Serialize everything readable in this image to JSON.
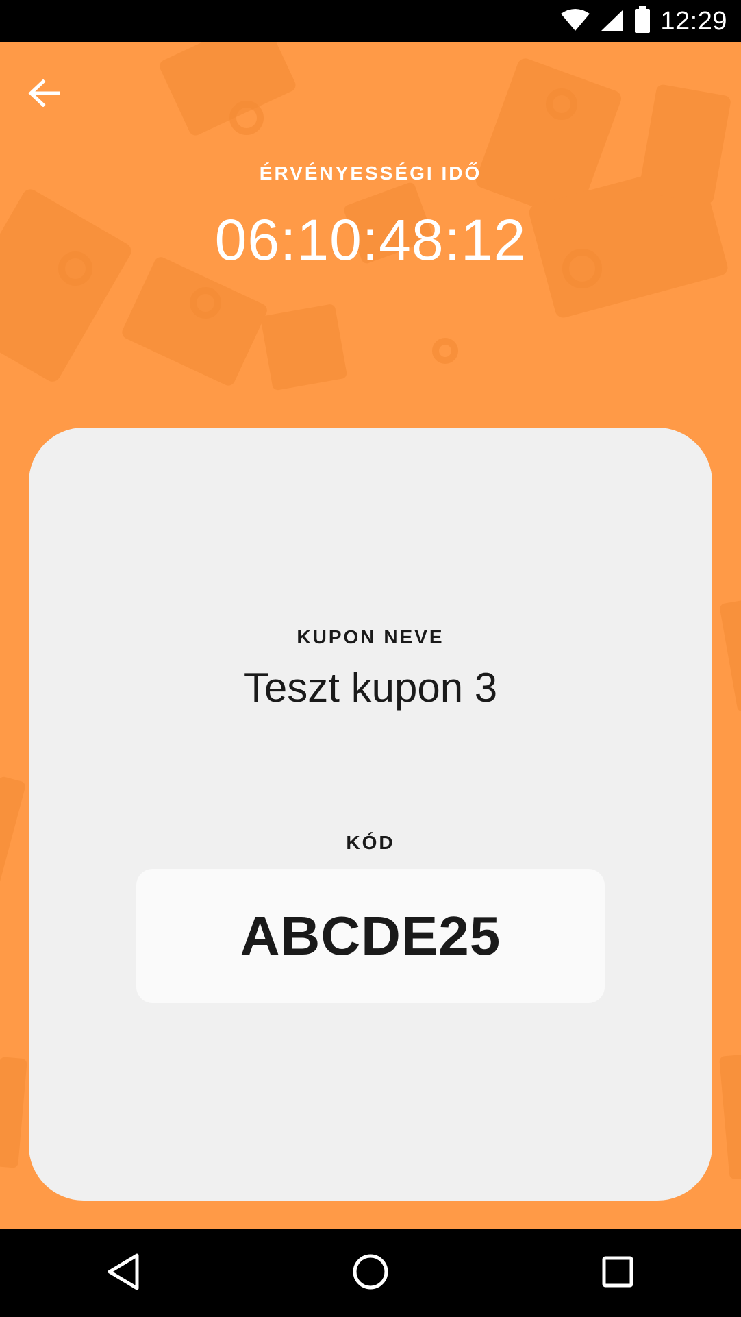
{
  "status_bar": {
    "time": "12:29",
    "icons": [
      "wifi-icon",
      "signal-icon",
      "battery-icon"
    ]
  },
  "header": {
    "back_icon": "arrow-back-icon",
    "validity_label": "ÉRVÉNYESSÉGI IDŐ",
    "countdown": "06:10:48:12"
  },
  "card": {
    "coupon_name_label": "KUPON NEVE",
    "coupon_name": "Teszt kupon 3",
    "code_label": "KÓD",
    "code_value": "ABCDE25"
  },
  "nav_bar": {
    "icons": [
      "back-triangle-icon",
      "home-circle-icon",
      "recents-square-icon"
    ]
  },
  "colors": {
    "accent": "#FF9A47",
    "card": "#F0F0F0",
    "code_box": "#FAFAFA",
    "text_dark": "#1a1a1a"
  }
}
